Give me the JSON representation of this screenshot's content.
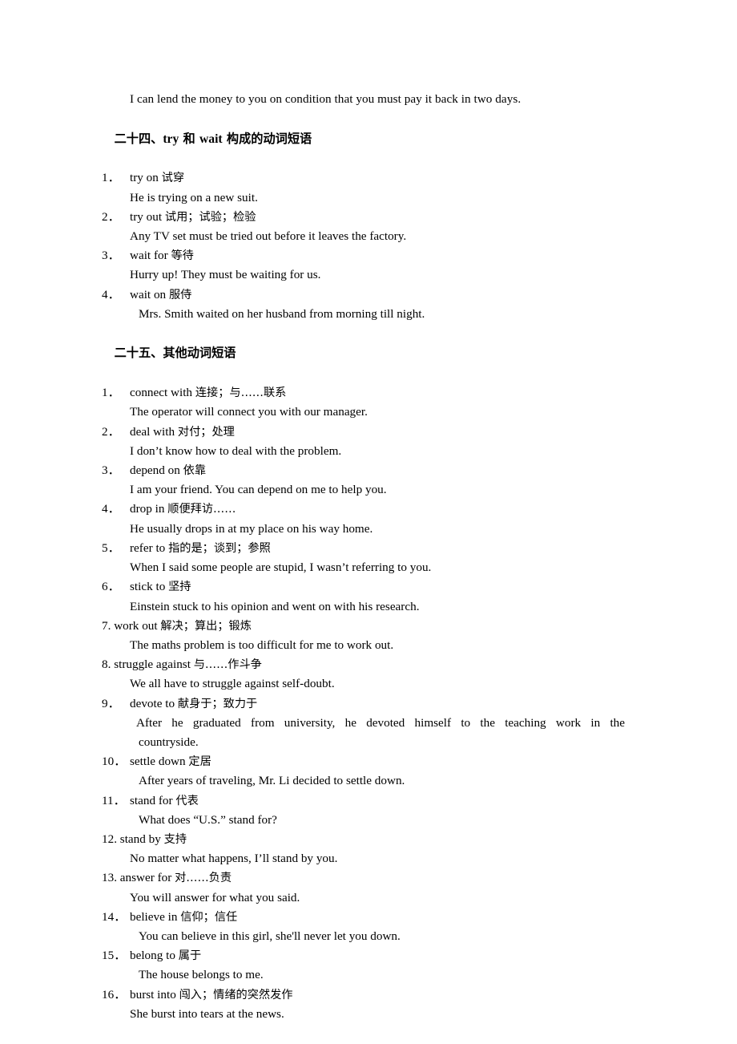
{
  "document": {
    "lead_example": "I can lend the money to you on condition that you must pay it back in two days."
  },
  "sections": [
    {
      "heading_prefix": "二十四、",
      "heading_en1": "try",
      "heading_mid": " 和 ",
      "heading_en2": "wait",
      "heading_suffix": " 构成的动词短语",
      "heading_full": "二十四、try 和 wait 构成的动词短语",
      "entries": [
        {
          "num": "1．",
          "phrase": "try on ",
          "gloss": "试穿",
          "examples": [
            "He is trying on a new suit."
          ]
        },
        {
          "num": "2．",
          "phrase": "try out ",
          "gloss": "试用；试验；检验",
          "examples": [
            "Any TV set must be tried out before it leaves the factory."
          ]
        },
        {
          "num": "3．",
          "phrase": "wait for ",
          "gloss": "等待",
          "examples": [
            "Hurry up! They must be waiting for us."
          ]
        },
        {
          "num": "4．",
          "phrase": "wait on ",
          "gloss": "服侍",
          "examples": [
            "Mrs. Smith waited on her husband from morning till night."
          ]
        }
      ]
    },
    {
      "heading_full": "二十五、其他动词短语",
      "entries": [
        {
          "num": "1．",
          "phrase": "connect with ",
          "gloss": "连接；与……联系",
          "examples": [
            "The operator will connect you with our manager."
          ]
        },
        {
          "num": "2．",
          "phrase": "deal with ",
          "gloss": "对付；处理",
          "examples": [
            "I don’t know how to deal with the problem."
          ]
        },
        {
          "num": "3．",
          "phrase": "depend on ",
          "gloss": "依靠",
          "examples": [
            "I am your friend. You can depend on me to help you."
          ]
        },
        {
          "num": "4．",
          "phrase": "drop in ",
          "gloss": "顺便拜访……",
          "examples": [
            "He usually drops in at my place on his way home."
          ]
        },
        {
          "num": "5．",
          "phrase": "refer to ",
          "gloss": "指的是；谈到；参照",
          "examples": [
            "When I said some people are stupid, I wasn’t referring to you."
          ]
        },
        {
          "num": "6．",
          "phrase": "stick to ",
          "gloss": "坚持",
          "examples": [
            "Einstein stuck to his opinion and went on with his research."
          ]
        },
        {
          "num": "7. ",
          "phrase": "work out ",
          "gloss": "解决；算出；锻炼",
          "examples": [
            "The maths problem is too difficult for me to work out."
          ]
        },
        {
          "num": "8. ",
          "phrase": "struggle against ",
          "gloss": "与……作斗争",
          "examples": [
            "We all have to struggle against self-doubt."
          ]
        },
        {
          "num": "9．",
          "phrase": "devote to ",
          "gloss": "献身于；致力于",
          "examples": [
            "After he graduated from university, he devoted himself to the teaching work in the",
            "countryside."
          ]
        },
        {
          "num": "10．",
          "phrase": "settle down ",
          "gloss": "定居",
          "examples": [
            "After years of traveling, Mr. Li decided to settle down."
          ]
        },
        {
          "num": "11．",
          "phrase": "stand for ",
          "gloss": "代表",
          "examples": [
            "What does “U.S.” stand for?"
          ]
        },
        {
          "num": "12. ",
          "phrase": "stand by ",
          "gloss": "支持",
          "examples": [
            "No matter what happens, I’ll stand by you."
          ]
        },
        {
          "num": "13. ",
          "phrase": "answer for ",
          "gloss": "对……负责",
          "examples": [
            "You will answer for what you said."
          ]
        },
        {
          "num": "14．",
          "phrase": "believe in ",
          "gloss": "信仰；信任",
          "examples": [
            "You can believe in this girl, she'll never let you down."
          ]
        },
        {
          "num": "15．",
          "phrase": "belong to ",
          "gloss": "属于",
          "examples": [
            "The house belongs to me."
          ]
        },
        {
          "num": "16．",
          "phrase": "burst into ",
          "gloss": "闯入；情绪的突然发作",
          "examples": [
            "She burst into tears at the news."
          ]
        }
      ]
    }
  ],
  "colors": {
    "page_background": "#ffffff",
    "text": "#000000"
  }
}
